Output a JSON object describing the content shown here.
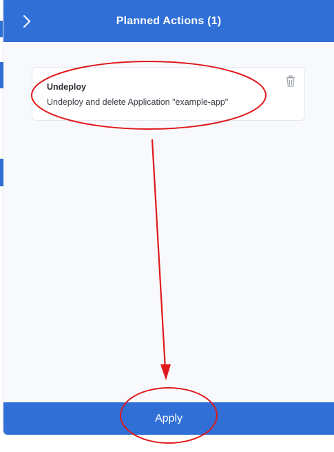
{
  "drawer": {
    "title": "Planned Actions (1)",
    "collapse_icon": "chevron-right-icon"
  },
  "actions": [
    {
      "title": "Undeploy",
      "description": "Undeploy and delete Application \"example-app\"",
      "delete_icon": "trash-icon"
    }
  ],
  "footer": {
    "apply_label": "Apply"
  },
  "colors": {
    "primary": "#2f6fd6",
    "panel_bg": "#f8f9fc",
    "annotation": "#e0191b"
  }
}
